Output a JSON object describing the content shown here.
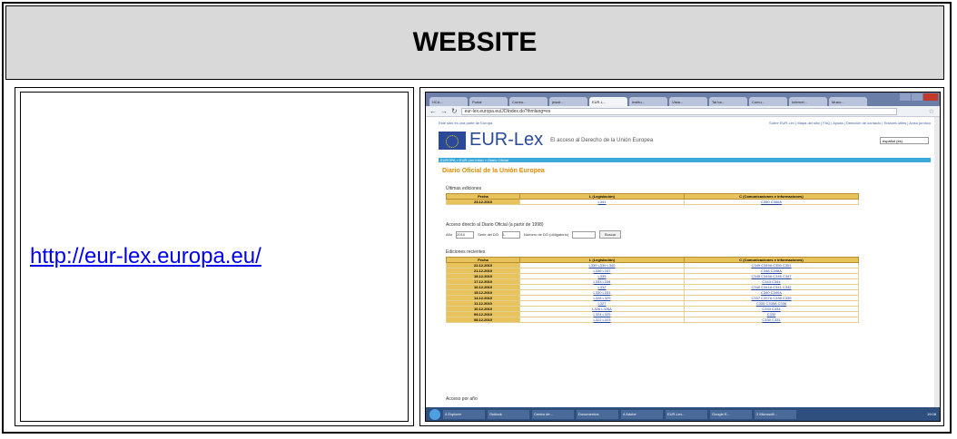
{
  "header": {
    "title": "WEBSITE"
  },
  "link": {
    "text": "http://eur-lex.europa.eu/"
  },
  "screenshot": {
    "tabs": [
      "HCA...",
      "Portal",
      "Correo...",
      "jesuit...",
      "EUR-L...",
      "Institu...",
      "Vista...",
      "Tal ba...",
      "Comu...",
      "Internet...",
      "Music...",
      "DOC...",
      "..."
    ],
    "address": "eur-lex.europa.eu/JOIndex.do?ihmlang=es",
    "topline_left": "Este sitio es una parte de Europa",
    "topline_right": "Sobre EUR-Lex | Mapa del sitio | FAQ | Ayuda | Dirección de contacto | Enlaces útiles | Aviso jurídico",
    "logo": "EUR-Lex",
    "logo_sub": "El acceso al Derecho de la Unión Europea",
    "lang": "español (es)",
    "breadcrumb": "EUROPA > EUR-Lex Inicio > Diario Oficial",
    "page_title": "Diario Oficial de la Unión Europea",
    "last_title": "Últimas ediciones",
    "col_date": "Fecha",
    "col_l": "L (Legislación)",
    "col_c": "C (Comunicaciones e informaciones)",
    "last_row": {
      "date": "23.12.2010",
      "l": "L341",
      "c": "C350 C350A"
    },
    "access_title": "Acceso directo al Diario Oficial (a partir de 1998)",
    "year_label": "Año",
    "year_value": "2010",
    "series_label": "Serie del DO",
    "series_value": "L",
    "number_label": "Número de DO (obligatorio)",
    "search_btn": "Buscar",
    "recent_title": "Ediciones recientes",
    "recent_rows": [
      {
        "date": "22.12.2010",
        "l": "L339 L339 L340",
        "c": "C349 C349A C350 C351"
      },
      {
        "date": "21.12.2010",
        "l": "L336 L337",
        "c": "C348 C348A"
      },
      {
        "date": "18.12.2010",
        "l": "L335",
        "c": "C345 C345A C346 C347"
      },
      {
        "date": "17.12.2010",
        "l": "L333 L334",
        "c": "C343 C344"
      },
      {
        "date": "16.12.2010",
        "l": "L332",
        "c": "C340 C341A C341 C342"
      },
      {
        "date": "15.12.2010",
        "l": "L330 L331",
        "c": "C340 C340A"
      },
      {
        "date": "14.12.2010",
        "l": "L328 L329",
        "c": "C337 C337A C338 C339"
      },
      {
        "date": "11.12.2010",
        "l": "L327",
        "c": "C335 C335A C336"
      },
      {
        "date": "10.12.2010",
        "l": "L326 L326A",
        "c": "C333 C334"
      },
      {
        "date": "09.12.2010",
        "l": "L324 L325",
        "c": "C332"
      },
      {
        "date": "08.12.2010",
        "l": "L322 L323",
        "c": "C330 C331"
      }
    ],
    "year_access": "Acceso por año",
    "taskbar_items": [
      "4 Explorer",
      "Outlook",
      "Centro de...",
      "Documentos",
      "4 Adobe",
      "EUR-Lex...",
      "Google E...",
      "2 Microsoft..."
    ],
    "clock": "19:08"
  }
}
